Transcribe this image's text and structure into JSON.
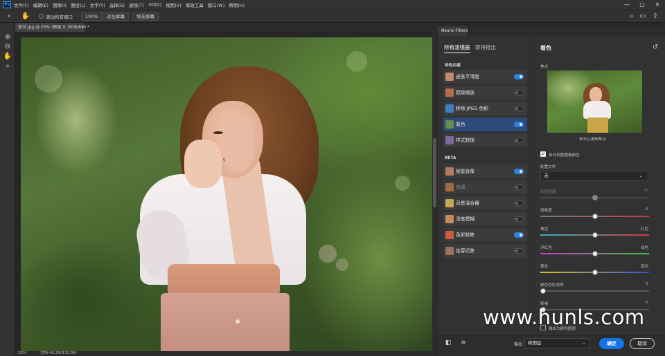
{
  "menubar": {
    "app_logo": "Ps",
    "items": [
      "文件(F)",
      "编辑(E)",
      "图像(I)",
      "图层(L)",
      "文字(Y)",
      "选择(S)",
      "滤镜(T)",
      "3D(D)",
      "视图(V)",
      "增效工具",
      "窗口(W)",
      "帮助(H)"
    ],
    "win_minimize": "—",
    "win_maximize": "▢",
    "win_close": "✕"
  },
  "optionsbar": {
    "scroll_all_label": "滚动所有窗口",
    "zoom_100": "100%",
    "fit_screen": "适合屏幕",
    "fill_screen": "填充屏幕"
  },
  "document": {
    "tab_title": "测试.jpg @ 25% (图层 0, RGB/8#) *",
    "status_zoom": "25%",
    "status_text": "文档:46.2M/132.3M"
  },
  "neural_filters": {
    "panel_tab": "Neural Filters",
    "tab_all": "所有滤镜器",
    "tab_upcoming": "即将推出",
    "section_featured": "特色内容",
    "section_beta": "BETA",
    "featured": [
      {
        "label": "皮肤平滑度",
        "on": true,
        "dim": false,
        "selected": false,
        "thumb": "#c48a6a"
      },
      {
        "label": "超级缩放",
        "on": false,
        "dim": false,
        "selected": false,
        "thumb": "#b86d4a"
      },
      {
        "label": "移除 JPEG 伪影",
        "on": false,
        "dim": false,
        "selected": false,
        "thumb": "#3a7fc0"
      },
      {
        "label": "着色",
        "on": true,
        "dim": false,
        "selected": true,
        "thumb": "#6a8c4a"
      },
      {
        "label": "样式转换",
        "on": false,
        "dim": false,
        "selected": false,
        "thumb": "#7a6aa0"
      }
    ],
    "beta": [
      {
        "label": "智能肖像",
        "on": true,
        "dim": false,
        "selected": false,
        "thumb": "#b57a5e"
      },
      {
        "label": "协调",
        "on": false,
        "dim": true,
        "selected": false,
        "thumb": "#a06a40"
      },
      {
        "label": "风景混合器",
        "on": false,
        "dim": false,
        "selected": false,
        "thumb": "#c9a55a"
      },
      {
        "label": "深度模糊",
        "on": false,
        "dim": false,
        "selected": false,
        "thumb": "#c98a5a"
      },
      {
        "label": "色彩转移",
        "on": true,
        "dim": false,
        "selected": false,
        "thumb": "#d05a3a"
      },
      {
        "label": "妆容迁移",
        "on": false,
        "dim": false,
        "selected": false,
        "thumb": "#9a7060"
      }
    ],
    "settings": {
      "title": "着色",
      "focus_label": "焦点",
      "preview_caption": "单击以编辑焦点",
      "auto_color_label": "自动调整图像颜色",
      "auto_color_checked": true,
      "profile_label": "配置文件",
      "profile_value": "无",
      "profile_strength_label": "轮廓强度",
      "profile_strength_value": "50",
      "saturation_label": "饱和度",
      "saturation_value": "0",
      "cyan_label": "青色",
      "red_label": "红色",
      "magenta_label": "洋红色",
      "green_label": "绿色",
      "yellow_label": "黄色",
      "blue_label": "蓝色",
      "artifact_label": "颜色伪影消除",
      "artifact_value": "0",
      "noise_label": "降噪",
      "noise_value": "0",
      "output_color_layer_label": "输出为颜色图层"
    },
    "sliders": {
      "profile_strength": 0.5,
      "saturation": 0.5,
      "cyan_red": 0.5,
      "magenta_green": 0.5,
      "yellow_blue": 0.5,
      "artifact": 0.0,
      "noise": 0.0
    },
    "output_label": "输出",
    "output_value": "新图层",
    "ok_label": "确定",
    "cancel_label": "取消"
  },
  "watermark": "www.hunls.com",
  "colors": {
    "accent_blue": "#1473e6",
    "selected_row": "#2c4a7a",
    "toggle_on": "#2f7ee0"
  }
}
